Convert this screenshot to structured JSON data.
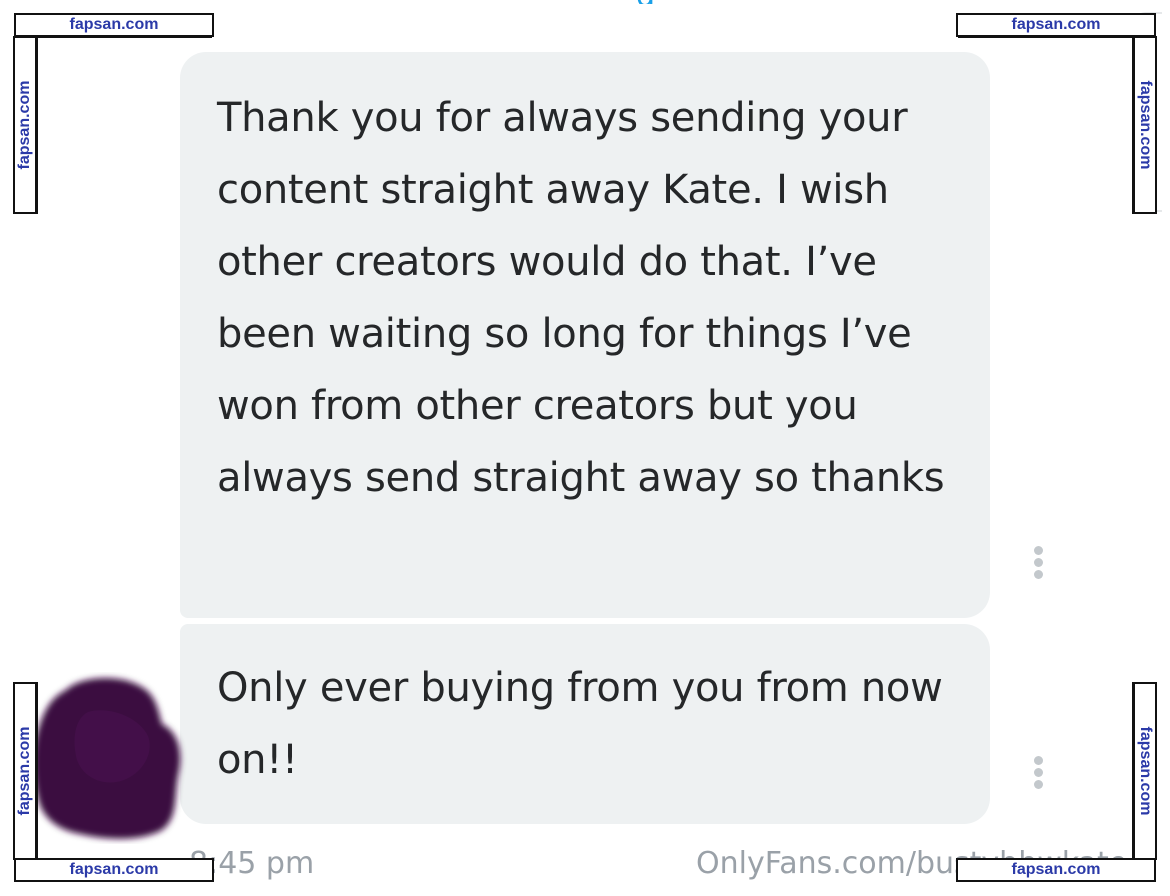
{
  "messages": [
    {
      "text": "Thank you for always sending your content straight away Kate. I wish other creators would do that. I’ve been waiting so long for things I’ve won from other creators but you always send straight away so thanks"
    },
    {
      "text": "Only ever buying from you from now on!!"
    }
  ],
  "footer": {
    "timestamp": "8:45 pm",
    "source_url": "OnlyFans.com/bustybbwkate"
  },
  "watermark": {
    "text": "fapsan.com",
    "color": "#2b3aa8"
  },
  "colors": {
    "bubble_background": "#eef1f2",
    "message_text": "#252729",
    "meta_text": "#9aa1a8",
    "avatar_scribble": "#3a0a3f"
  },
  "icons": {
    "message_menu": "vertical-ellipsis-icon",
    "avatar": "scribbled-avatar"
  }
}
